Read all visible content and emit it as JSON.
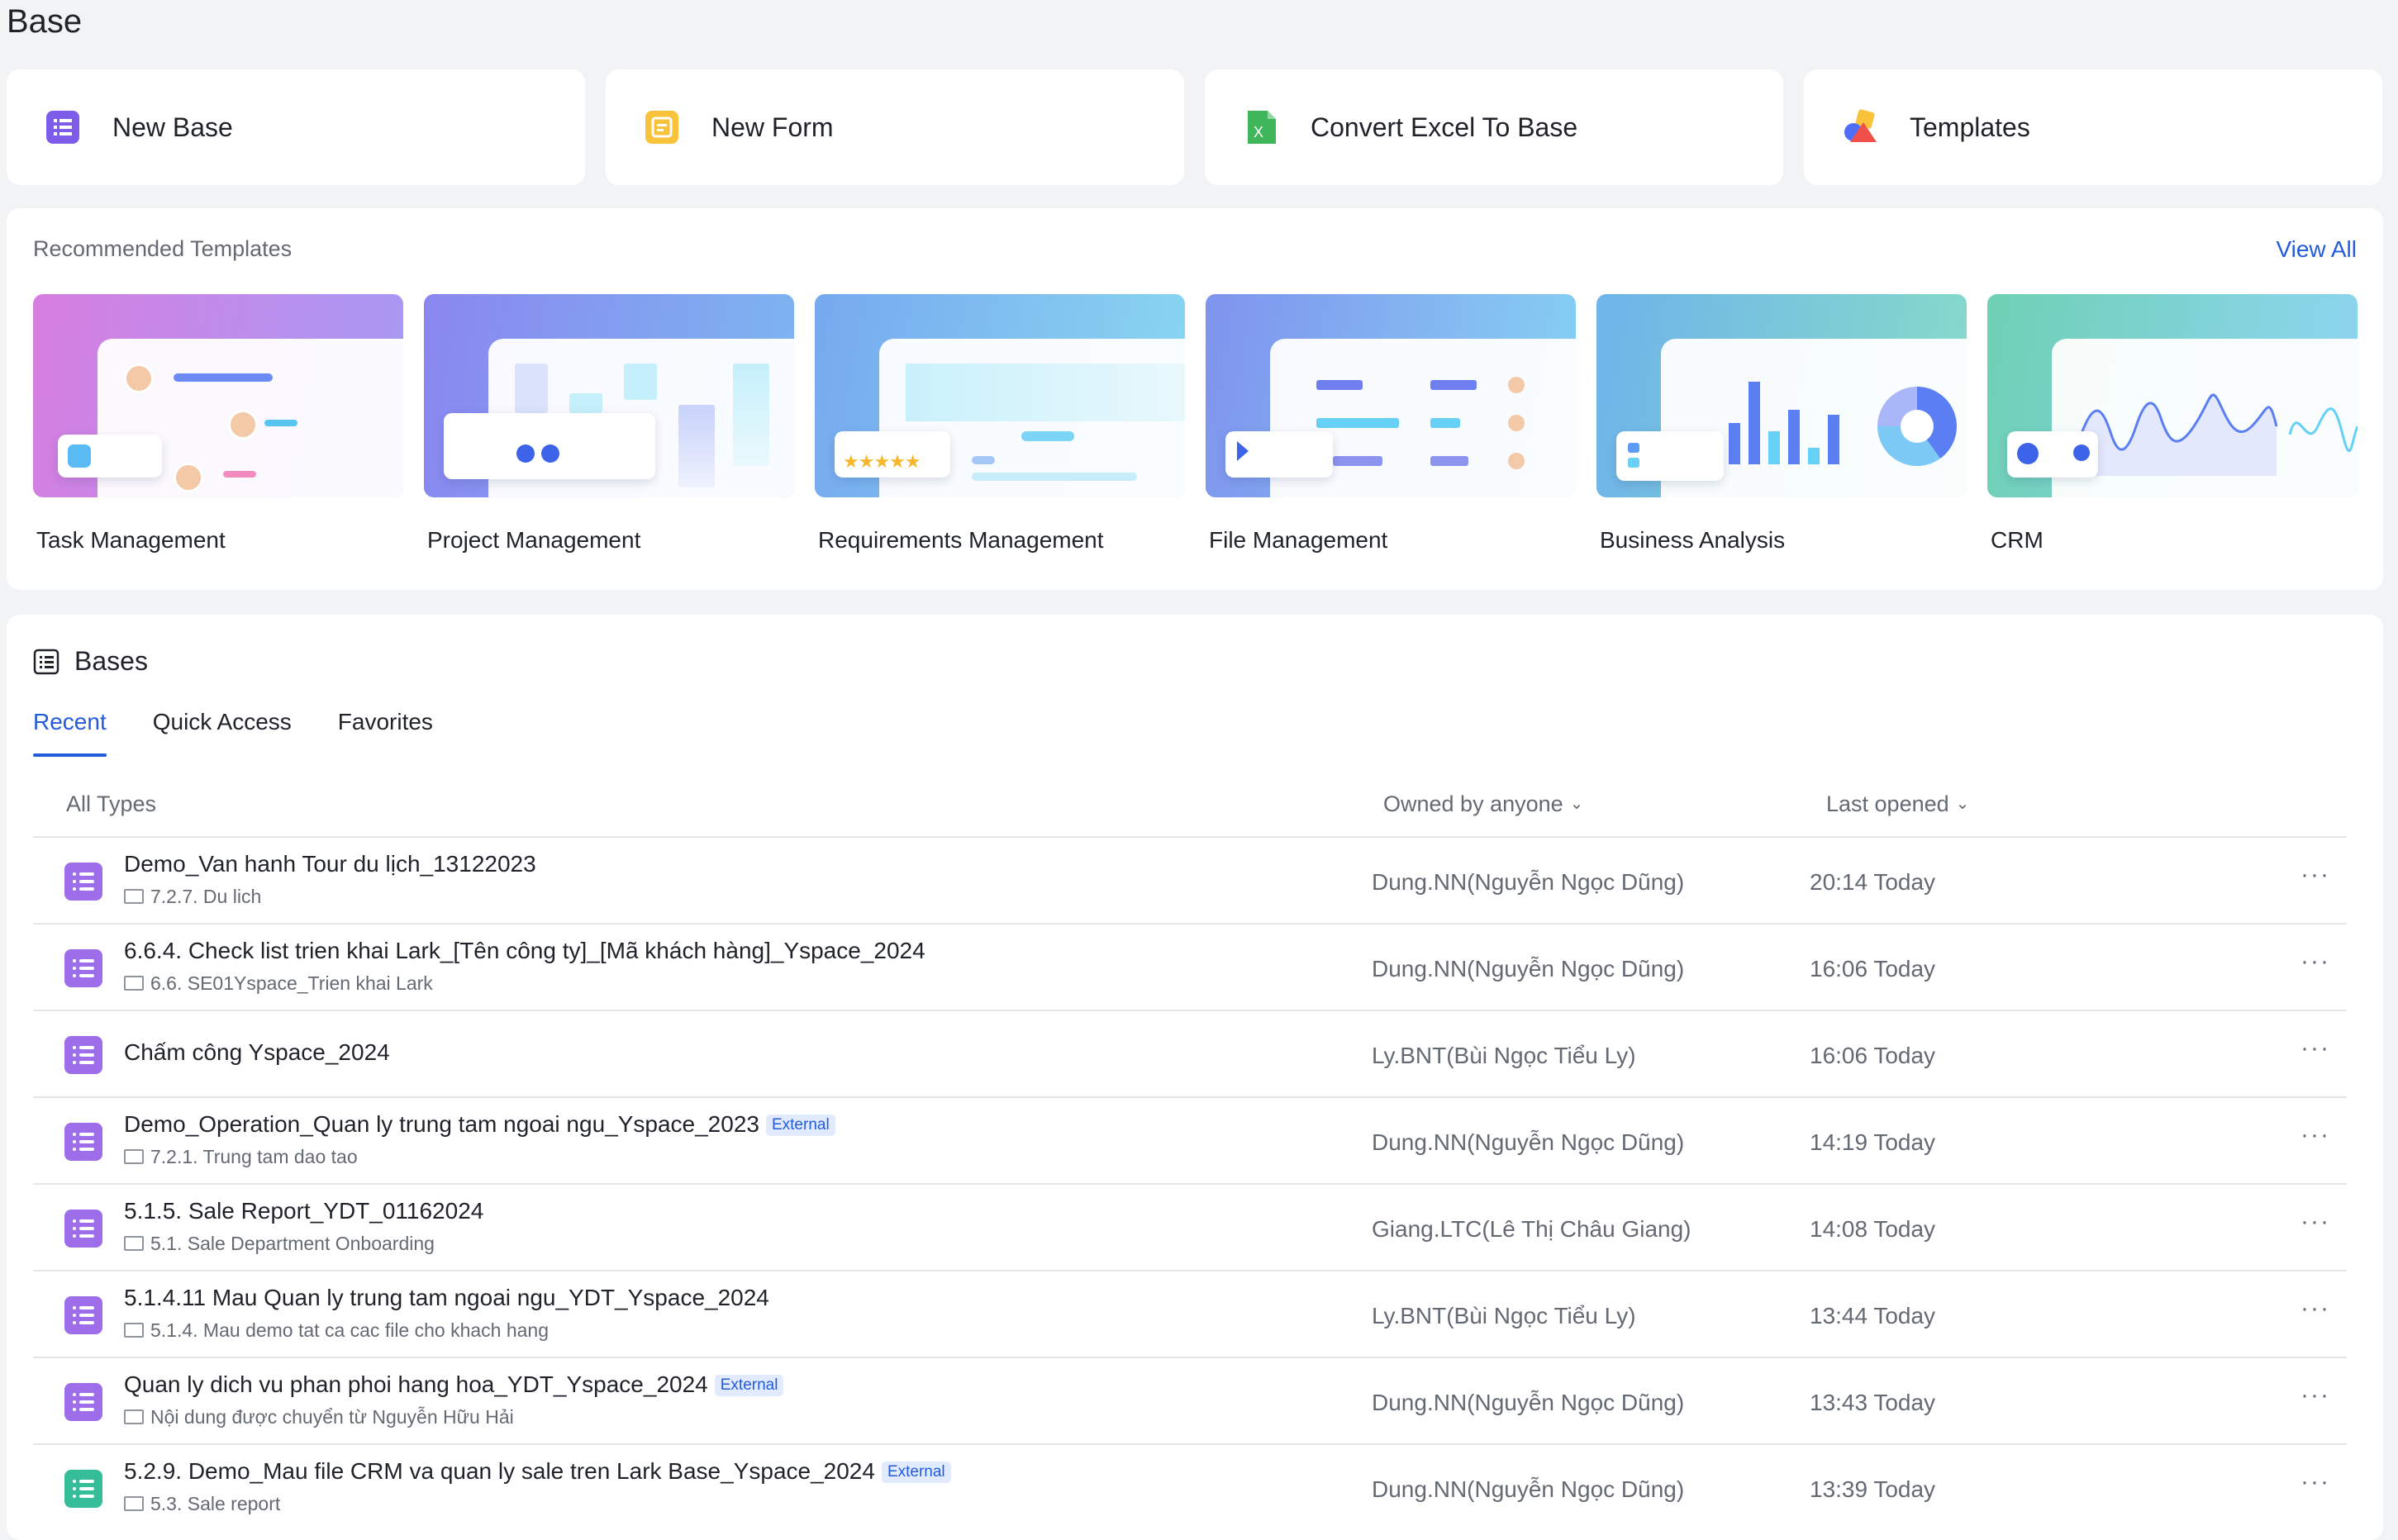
{
  "page_title": "Base",
  "actions": [
    {
      "label": "New Base",
      "icon": "new-base-icon"
    },
    {
      "label": "New Form",
      "icon": "new-form-icon"
    },
    {
      "label": "Convert Excel To Base",
      "icon": "excel-icon"
    },
    {
      "label": "Templates",
      "icon": "templates-icon"
    }
  ],
  "recommended": {
    "title": "Recommended Templates",
    "view_all": "View All",
    "templates": [
      {
        "name": "Task Management"
      },
      {
        "name": "Project Management"
      },
      {
        "name": "Requirements Management"
      },
      {
        "name": "File Management"
      },
      {
        "name": "Business Analysis"
      },
      {
        "name": "CRM"
      }
    ]
  },
  "bases": {
    "title": "Bases",
    "tabs": [
      {
        "label": "Recent",
        "active": true
      },
      {
        "label": "Quick Access",
        "active": false
      },
      {
        "label": "Favorites",
        "active": false
      }
    ],
    "filters": {
      "types": "All Types",
      "owner": "Owned by anyone",
      "sort": "Last opened"
    },
    "rows": [
      {
        "title": "Demo_Van hanh Tour du lịch_13122023",
        "external": "",
        "path": "7.2.7. Du lich",
        "owner": "Dung.NN(Nguyễn Ngọc Dũng)",
        "time": "20:14 Today",
        "icon": "base"
      },
      {
        "title": "6.6.4. Check list trien khai Lark_[Tên công ty]_[Mã khách hàng]_Yspace_2024",
        "external": "",
        "path": "6.6. SE01Yspace_Trien khai Lark",
        "owner": "Dung.NN(Nguyễn Ngọc Dũng)",
        "time": "16:06 Today",
        "icon": "base"
      },
      {
        "title": "Chấm công Yspace_2024",
        "external": "",
        "path": "",
        "owner": "Ly.BNT(Bùi Ngọc Tiểu Ly)",
        "time": "16:06 Today",
        "icon": "base"
      },
      {
        "title": "Demo_Operation_Quan ly trung tam ngoai ngu_Yspace_2023",
        "external": "External",
        "path": "7.2.1. Trung tam dao tao",
        "owner": "Dung.NN(Nguyễn Ngọc Dũng)",
        "time": "14:19 Today",
        "icon": "base"
      },
      {
        "title": "5.1.5. Sale Report_YDT_01162024",
        "external": "",
        "path": "5.1. Sale Department Onboarding",
        "owner": "Giang.LTC(Lê Thị Châu Giang)",
        "time": "14:08 Today",
        "icon": "base"
      },
      {
        "title": "5.1.4.11 Mau Quan ly trung tam ngoai ngu_YDT_Yspace_2024",
        "external": "",
        "path": "5.1.4. Mau demo tat ca cac file cho khach hang",
        "owner": "Ly.BNT(Bùi Ngọc Tiểu Ly)",
        "time": "13:44 Today",
        "icon": "base"
      },
      {
        "title": "Quan ly dich vu phan phoi hang hoa_YDT_Yspace_2024",
        "external": "External",
        "path": "Nội dung được chuyển từ Nguyễn Hữu Hải",
        "owner": "Dung.NN(Nguyễn Ngọc Dũng)",
        "time": "13:43 Today",
        "icon": "base"
      },
      {
        "title": "5.2.9. Demo_Mau file CRM va quan ly sale tren Lark Base_Yspace_2024",
        "external": "External",
        "path": "5.3. Sale report",
        "owner": "Dung.NN(Nguyễn Ngọc Dũng)",
        "time": "13:39 Today",
        "icon": "base-teal"
      }
    ]
  },
  "colors": {
    "accent": "#245bdb",
    "base_icon": "#9d6dea",
    "form_icon": "#f8c23a",
    "excel_icon": "#3fb65a"
  }
}
